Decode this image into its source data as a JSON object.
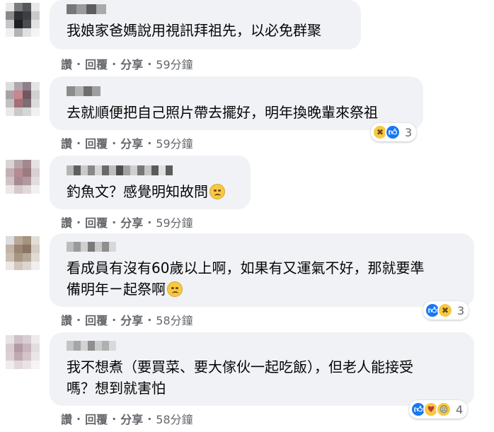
{
  "comments": [
    {
      "text": "我娘家爸媽說用視訊拜祖先，以必免群聚",
      "actions": {
        "like": "讚",
        "reply": "回覆",
        "share": "分享",
        "time": "59分鐘"
      },
      "reactions": null
    },
    {
      "text": "去就順便把自己照片帶去擺好，明年換晚輩來祭祖",
      "actions": {
        "like": "讚",
        "reply": "回覆",
        "share": "分享",
        "time": "59分鐘"
      },
      "reactions": {
        "icons": [
          "haha",
          "like"
        ],
        "count": "3"
      }
    },
    {
      "text": "釣魚文？感覺明知故問",
      "emoji": "eye-roll",
      "actions": {
        "like": "讚",
        "reply": "回覆",
        "share": "分享",
        "time": "59分鐘"
      },
      "reactions": null
    },
    {
      "text": "看成員有沒有60歲以上啊，如果有又運氣不好，那就要準\n備明年ㄧ起祭啊",
      "emoji": "woozy",
      "actions": {
        "like": "讚",
        "reply": "回覆",
        "share": "分享",
        "time": "58分鐘"
      },
      "reactions": {
        "icons": [
          "like",
          "haha"
        ],
        "count": "3"
      }
    },
    {
      "text": "我不想煮（要買菜、要大傢伙一起吃飯），但老人能接受\n嗎？想到就害怕",
      "actions": {
        "like": "讚",
        "reply": "回覆",
        "share": "分享",
        "time": "58分鐘"
      },
      "reactions": {
        "icons": [
          "like",
          "care",
          "sad"
        ],
        "count": "4"
      }
    }
  ],
  "colors": {
    "bubble": "#f0f2f5",
    "meta": "#65676b",
    "like": "#1877f2"
  }
}
